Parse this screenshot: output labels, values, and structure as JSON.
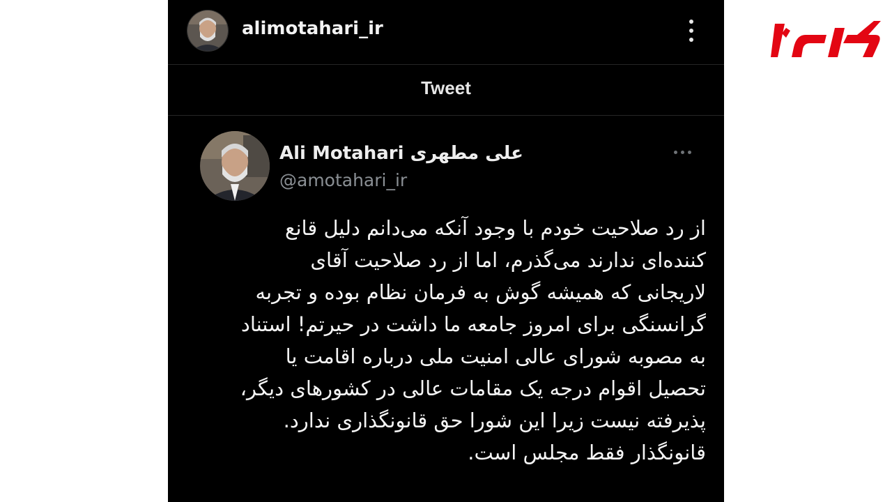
{
  "instagram": {
    "username": "alimotahari_ir",
    "menu_icon": "more-vertical-icon"
  },
  "tweet_bar": {
    "title": "Tweet"
  },
  "tweet": {
    "display_name": "Ali Motahari علی مطهری",
    "handle": "@amotahari_ir",
    "more_icon": "more-horizontal-icon",
    "lines": [
      "از رد صلاحیت خودم با وجود آنکه می‌دانم دلیل قانع",
      "کننده‌ای ندارند می‌گذرم، اما از رد صلاحیت آقای",
      "لاریجانی که همیشه گوش به فرمان نظام بوده و تجربه",
      "گرانسنگی برای امروز جامعه ما داشت در حیرتم! استناد",
      "به مصوبه شورای عالی امنیت ملی درباره اقامت یا",
      "تحصیل اقوام درجه یک مقامات عالی در کشورهای دیگر،",
      "پذیرفته نیست زیرا این شورا حق قانونگذاری ندارد.",
      "قانونگذار فقط مجلس است."
    ]
  },
  "colors": {
    "background": "#000000",
    "text": "#f4f4f4",
    "muted": "#8a8f94",
    "logo": "#e30613"
  }
}
